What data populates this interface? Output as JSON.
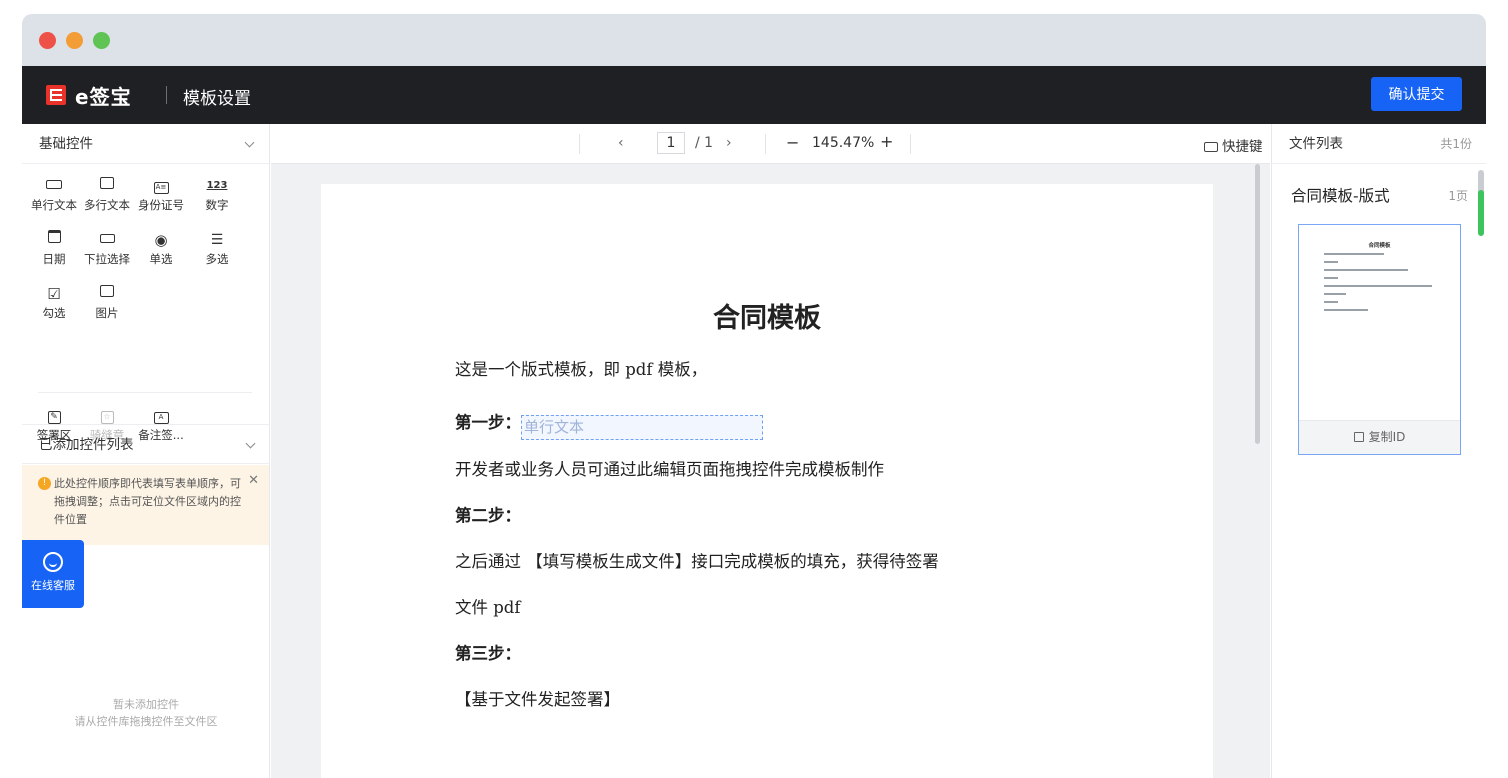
{
  "app": {
    "brand": "e签宝",
    "title": "模板设置",
    "submit_label": "确认提交"
  },
  "left": {
    "basic_title": "基础控件",
    "controls": [
      {
        "icon": "single-line-text-icon",
        "label": "单行文本"
      },
      {
        "icon": "multi-line-text-icon",
        "label": "多行文本"
      },
      {
        "icon": "id-card-icon",
        "label": "身份证号"
      },
      {
        "icon": "number-icon",
        "label": "数字",
        "glyph": "123"
      },
      {
        "icon": "calendar-icon",
        "label": "日期"
      },
      {
        "icon": "dropdown-icon",
        "label": "下拉选择"
      },
      {
        "icon": "radio-icon",
        "label": "单选"
      },
      {
        "icon": "checklist-icon",
        "label": "多选"
      },
      {
        "icon": "checkbox-icon",
        "label": "勾选"
      },
      {
        "icon": "image-icon",
        "label": "图片"
      },
      {
        "icon": "sign-area-icon",
        "label": "签署区"
      },
      {
        "icon": "seal-icon",
        "label": "骑缝章"
      },
      {
        "icon": "note-sign-icon",
        "label": "备注签..."
      }
    ],
    "added_title": "已添加控件列表",
    "notice": "此处控件顺序即代表填写表单顺序，可拖拽调整；点击可定位文件区域内的控件位置",
    "empty_line1": "暂未添加控件",
    "empty_line2": "请从控件库拖拽控件至文件区",
    "service_label": "在线客服"
  },
  "toolbar": {
    "page_current": "1",
    "page_total": "/ 1",
    "zoom": "145.47%",
    "shortcut_label": "快捷键"
  },
  "doc": {
    "title": "合同模板",
    "line1": "这是一个版式模板，即 pdf 模板，",
    "step1": "第一步：",
    "field_placeholder": "单行文本",
    "line2": "开发者或业务人员可通过此编辑页面拖拽控件完成模板制作",
    "step2": "第二步：",
    "line3": "之后通过 【填写模板生成文件】接口完成模板的填充，获得待签署",
    "line4": "文件 pdf",
    "step3": "第三步：",
    "line5": "【基于文件发起签署】"
  },
  "right": {
    "title": "文件列表",
    "count": "共1份",
    "doc_name": "合同模板-版式",
    "pages": "1页",
    "thumb_title": "合同模板",
    "copy_label": "复制ID"
  }
}
